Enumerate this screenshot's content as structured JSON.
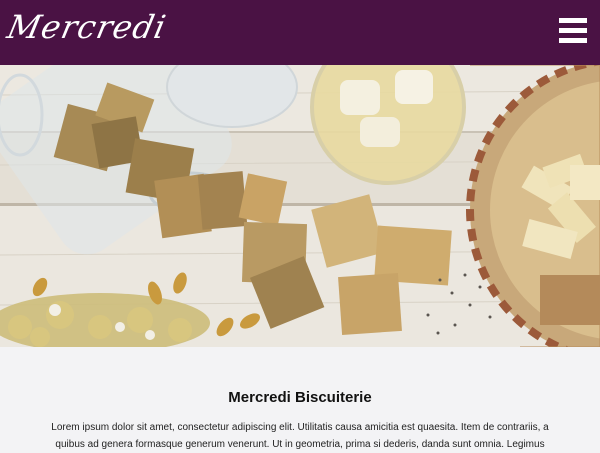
{
  "header": {
    "logo_text": "Mercredi",
    "menu_icon": "hamburger-menu-icon",
    "background_color": "#4a1244"
  },
  "hero": {
    "image_subject": "crackers-table-photo"
  },
  "main": {
    "title": "Mercredi Biscuiterie",
    "body": "Lorem ipsum dolor sit amet, consectetur adipiscing elit. Utilitatis causa amicitia est quaesita. Item de contrariis, a quibus ad genera formasque generum venerunt. Ut in geometria, prima si dederis, danda sunt omnia. Legimus"
  }
}
